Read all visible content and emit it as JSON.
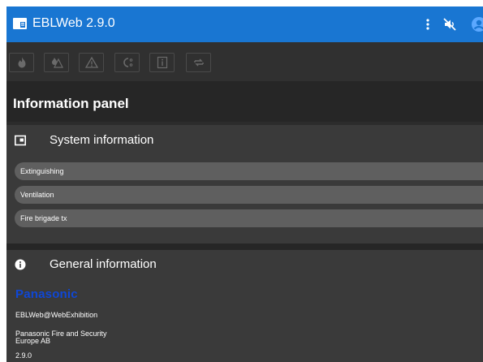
{
  "header": {
    "title": "EBLWeb 2.9.0",
    "icons": [
      "app-panel-icon",
      "more-vert-icon",
      "volume-off-icon",
      "account-icon"
    ],
    "accent": "#1976d2"
  },
  "toolbar": {
    "buttons": [
      "fire-icon",
      "fire-alarm-icon",
      "warning-icon",
      "disablement-icon",
      "info-icon",
      "loop-icon"
    ]
  },
  "panel": {
    "title": "Information panel"
  },
  "system_info": {
    "title": "System information",
    "items": [
      "Extinguishing",
      "Ventilation",
      "Fire brigade tx"
    ]
  },
  "general_info": {
    "title": "General information",
    "brand": "Panasonic",
    "brand_color": "#0f47d6",
    "host": "EBLWeb@WebExhibition",
    "company_line1": "Panasonic Fire and Security",
    "company_line2": "Europe AB",
    "version": "2.9.0"
  }
}
